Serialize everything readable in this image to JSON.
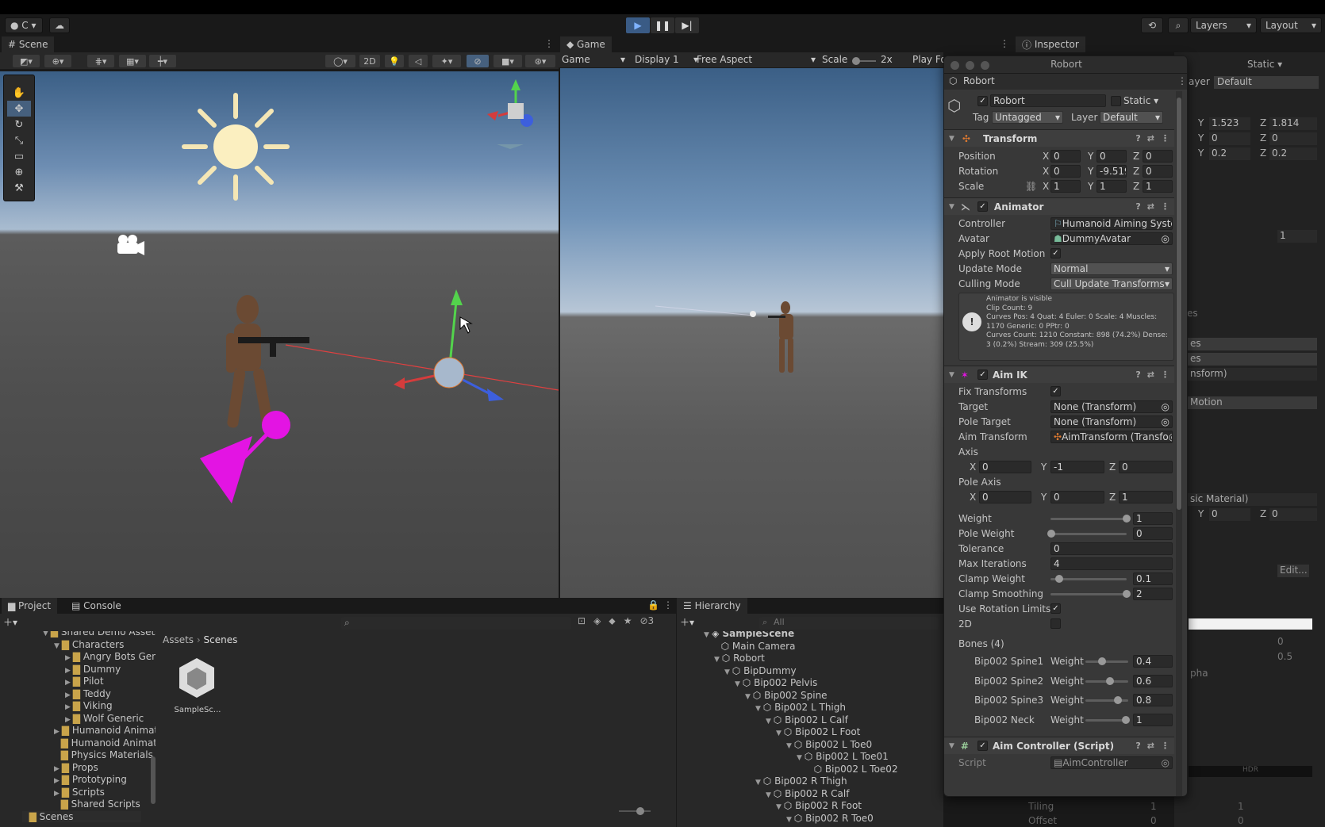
{
  "toolbar": {
    "account": "C",
    "layers_label": "Layers",
    "layout_label": "Layout"
  },
  "scene": {
    "tab": "Scene",
    "mode_2d": "2D"
  },
  "game": {
    "tab": "Game",
    "mode": "Game",
    "display": "Display 1",
    "aspect": "Free Aspect",
    "scale_label": "Scale",
    "scale_value": "2x",
    "play_focused": "Play Fo"
  },
  "inspector": {
    "tab": "Inspector",
    "window_title": "Robort",
    "object_name": "Robort",
    "name_field": "Robort",
    "static_label": "Static",
    "tag_label": "Tag",
    "tag_value": "Untagged",
    "layer_label": "Layer",
    "layer_value": "Default",
    "transform": {
      "title": "Transform",
      "position_label": "Position",
      "rotation_label": "Rotation",
      "scale_label": "Scale",
      "position": {
        "x": "0",
        "y": "0",
        "z": "0"
      },
      "rotation": {
        "x": "0",
        "y": "-9.519",
        "z": "0"
      },
      "scale": {
        "x": "1",
        "y": "1",
        "z": "1"
      }
    },
    "animator": {
      "title": "Animator",
      "controller_label": "Controller",
      "controller_value": "Humanoid Aiming Syste",
      "avatar_label": "Avatar",
      "avatar_value": "DummyAvatar",
      "apply_root_label": "Apply Root Motion",
      "update_mode_label": "Update Mode",
      "update_mode_value": "Normal",
      "culling_label": "Culling Mode",
      "culling_value": "Cull Update Transforms",
      "info": [
        "Animator is visible",
        "Clip Count: 9",
        "Curves Pos: 4 Quat: 4 Euler: 0 Scale: 4 Muscles:",
        "1170 Generic: 0 PPtr: 0",
        "Curves Count: 1210 Constant: 898 (74.2%) Dense:",
        "3 (0.2%) Stream: 309 (25.5%)"
      ]
    },
    "aimik": {
      "title": "Aim IK",
      "fix_label": "Fix Transforms",
      "target_label": "Target",
      "target_value": "None (Transform)",
      "pole_target_label": "Pole Target",
      "pole_target_value": "None (Transform)",
      "aim_transform_label": "Aim Transform",
      "aim_transform_value": "AimTransform (Transfo",
      "axis_label": "Axis",
      "axis": {
        "x": "0",
        "y": "-1",
        "z": "0"
      },
      "pole_axis_label": "Pole Axis",
      "pole_axis": {
        "x": "0",
        "y": "0",
        "z": "1"
      },
      "weight_label": "Weight",
      "weight_value": "1",
      "pole_weight_label": "Pole Weight",
      "pole_weight_value": "0",
      "tolerance_label": "Tolerance",
      "tolerance_value": "0",
      "max_iter_label": "Max Iterations",
      "max_iter_value": "4",
      "clamp_weight_label": "Clamp Weight",
      "clamp_weight_value": "0.1",
      "clamp_smooth_label": "Clamp Smoothing",
      "clamp_smooth_value": "2",
      "rot_limits_label": "Use Rotation Limits",
      "twod_label": "2D",
      "bones_label": "Bones (4)",
      "bone_weight_label": "Weight",
      "bones": [
        {
          "name": "Bip002 Spine1",
          "weight": "0.4",
          "frac": 0.4
        },
        {
          "name": "Bip002 Spine2",
          "weight": "0.6",
          "frac": 0.6
        },
        {
          "name": "Bip002 Spine3",
          "weight": "0.8",
          "frac": 0.8
        },
        {
          "name": "Bip002 Neck",
          "weight": "1",
          "frac": 1
        }
      ]
    },
    "aimcontroller": {
      "title": "Aim Controller (Script)",
      "script_label": "Script",
      "script_value": "AimController"
    }
  },
  "background_inspector": {
    "y1": "1.523",
    "z1": "1.814",
    "y2": "0",
    "z2": "0",
    "y3": "0.2",
    "z3": "0.2",
    "static": "Static",
    "layer_label": "ayer",
    "layer": "Default",
    "val1": "1",
    "motion": "Motion",
    "nsform": "nsform)",
    "es1": "es",
    "es2": "es",
    "material": "sic Material)",
    "y4": "0",
    "z4": "0",
    "edit": "Edit...",
    "v05": "0.5",
    "v0": "0",
    "pha": "pha",
    "hdr": "HDR",
    "tiling": "Tiling",
    "offset": "Offset",
    "tx": "1",
    "ty": "1",
    "ox": "0",
    "oy": "0"
  },
  "project": {
    "tab_project": "Project",
    "tab_console": "Console",
    "breadcrumb_root": "Assets",
    "breadcrumb_child": "Scenes",
    "hidden_count": "3",
    "tree": [
      "Shared Demo Assets",
      "Characters",
      "Angry Bots Gene",
      "Dummy",
      "Pilot",
      "Teddy",
      "Viking",
      "Wolf Generic",
      "Humanoid Animati",
      "Humanoid Animato",
      "Physics Materials",
      "Props",
      "Prototyping",
      "Scripts",
      "Shared Scripts",
      "Scenes"
    ],
    "asset_name": "SampleSc..."
  },
  "hierarchy": {
    "tab": "Hierarchy",
    "search_placeholder": "All",
    "items": [
      "SampleScene",
      "Main Camera",
      "Robort",
      "BipDummy",
      "Bip002 Pelvis",
      "Bip002 Spine",
      "Bip002 L Thigh",
      "Bip002 L Calf",
      "Bip002 L Foot",
      "Bip002 L Toe0",
      "Bip002 L Toe01",
      "Bip002 L Toe02",
      "Bip002 R Thigh",
      "Bip002 R Calf",
      "Bip002 R Foot",
      "Bip002 R Toe0"
    ]
  }
}
